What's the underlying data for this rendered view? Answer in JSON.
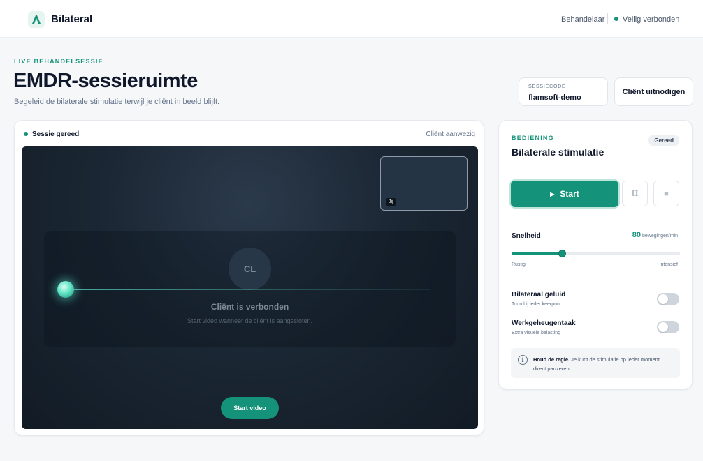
{
  "brand": {
    "name": "Bilateral",
    "logo_icon": "a-mark-icon",
    "accent": "#14937a"
  },
  "nav": {
    "role": "Behandelaar",
    "status": "Veilig verbonden"
  },
  "header": {
    "eyebrow": "LIVE BEHANDELSESSIE",
    "title": "EMDR-sessieruimte",
    "subtitle": "Begeleid de bilaterale stimulatie terwijl je cliënt in beeld blijft."
  },
  "session": {
    "code_label": "SESSIECODE",
    "code": "flamsoft-demo",
    "invite_label": "Cliënt uitnodigen"
  },
  "video": {
    "status": "Sessie gereed",
    "presence": "Cliënt aanwezig",
    "self_label": "Jij",
    "client_initials": "CL",
    "client_title": "Cliënt is verbonden",
    "client_sub": "Start video wanneer de cliënt is aangesloten.",
    "start_video_label": "Start video"
  },
  "controls": {
    "eyebrow": "BEDIENING",
    "title": "Bilaterale stimulatie",
    "badge": "Gereed",
    "start_label": "Start",
    "pause_glyph": "II",
    "stop_glyph": "■",
    "speed": {
      "label": "Snelheid",
      "value": "80",
      "unit": "bewegingen/min",
      "min_label": "Rustig",
      "max_label": "Intensief",
      "level_fraction": 0.3
    },
    "options": [
      {
        "title": "Bilateraal geluid",
        "sub": "Toon bij ieder keerpunt",
        "enabled": false
      },
      {
        "title": "Werkgeheugentaak",
        "sub": "Extra visuele belasting",
        "enabled": false
      }
    ],
    "info": {
      "bold": "Houd de regie.",
      "text": " Je kunt de stimulatie op ieder moment direct pauzeren."
    }
  }
}
